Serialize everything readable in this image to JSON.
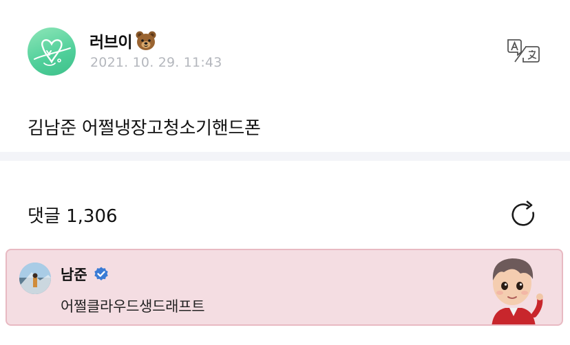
{
  "post": {
    "author_name": "러브이",
    "author_emoji": "bear-face-icon",
    "date": "2021. 10. 29. 11:43",
    "translate_icon": "translate-icon",
    "body": "김남준 어쩔냉장고청소기핸드폰"
  },
  "comments": {
    "label": "댓글",
    "count": "1,306",
    "refresh_icon": "refresh-icon"
  },
  "pinned_comment": {
    "author": "남준",
    "verified_icon": "verified-badge-icon",
    "text": "어쩔클라우드생드래프트",
    "background_color": "#f4dde2",
    "border_color": "#e8b9c2"
  },
  "colors": {
    "date_gray": "#b4b7bd",
    "verified_blue": "#3a7bd5",
    "avatar_green": "#4fcf9a",
    "divider": "#f3f4f8"
  }
}
